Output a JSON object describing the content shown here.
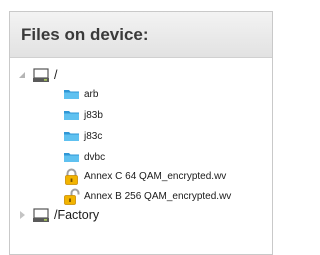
{
  "panel": {
    "title": "Files on device:"
  },
  "tree": {
    "root": {
      "label": "/",
      "expanded": true,
      "icon": "drive-icon",
      "children": [
        {
          "label": "arb",
          "icon": "folder-icon"
        },
        {
          "label": "j83b",
          "icon": "folder-icon"
        },
        {
          "label": "j83c",
          "icon": "folder-icon"
        },
        {
          "label": "dvbc",
          "icon": "folder-icon"
        },
        {
          "label": "Annex C 64 QAM_encrypted.wv",
          "icon": "lock-icon"
        },
        {
          "label": "Annex B 256 QAM_encrypted.wv",
          "icon": "lock-icon"
        }
      ]
    },
    "second_root": {
      "label": "/Factory",
      "expanded": false,
      "icon": "drive-icon"
    }
  },
  "colors": {
    "folder": "#3ea8e0",
    "lock": "#e8a800",
    "drive": "#5a5a5a"
  }
}
